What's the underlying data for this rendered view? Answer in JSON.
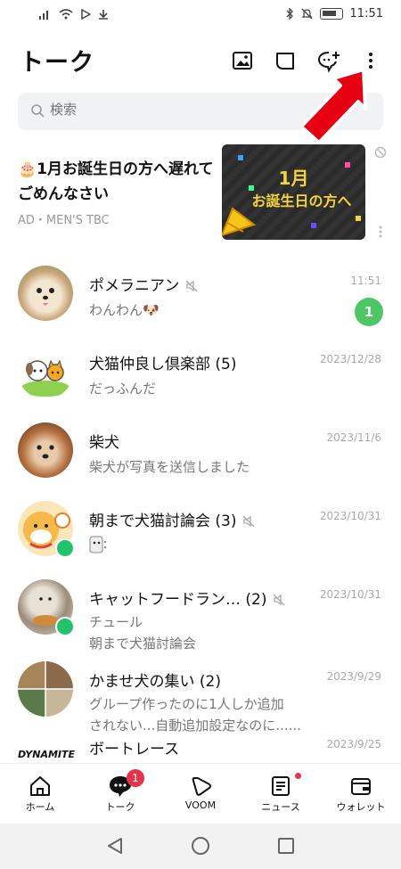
{
  "status_bar": {
    "time": "11:51"
  },
  "header": {
    "title": "トーク"
  },
  "search": {
    "placeholder": "検索"
  },
  "ad": {
    "title": "🎂1月お誕生日の方へ遅れてごめんなさい",
    "sponsor": "AD・MEN'S TBC",
    "banner_line1": "1月",
    "banner_line2": "お誕生日の方へ"
  },
  "chats": [
    {
      "name": "ポメラニアン",
      "preview": "わんわん🐶",
      "time": "11:51",
      "unread": "1",
      "muted": true
    },
    {
      "name": "犬猫仲良し倶楽部 (5)",
      "preview": "だっふんだ",
      "time": "2023/12/28"
    },
    {
      "name": "柴犬",
      "preview": "柴犬が写真を送信しました",
      "time": "2023/11/6"
    },
    {
      "name": "朝まで犬猫討論会 (3)",
      "preview": "",
      "time": "2023/10/31",
      "muted": true
    },
    {
      "name": "キャットフードラン…  (2)",
      "preview": "チュール",
      "preview2": "朝まで犬猫討論会",
      "time": "2023/10/31",
      "muted": true
    },
    {
      "name": "かませ犬の集い (2)",
      "preview": "グループ作ったのに1人しか追加",
      "preview2": "されない...自動追加設定なのに......",
      "time": "2023/9/29"
    },
    {
      "name": "ボートレース",
      "time": "2023/9/25",
      "avatar_text": "DYNAMITE"
    }
  ],
  "bottom_nav": [
    {
      "label": "ホーム"
    },
    {
      "label": "トーク",
      "badge": "1"
    },
    {
      "label": "VOOM"
    },
    {
      "label": "ニュース"
    },
    {
      "label": "ウォレット"
    }
  ]
}
